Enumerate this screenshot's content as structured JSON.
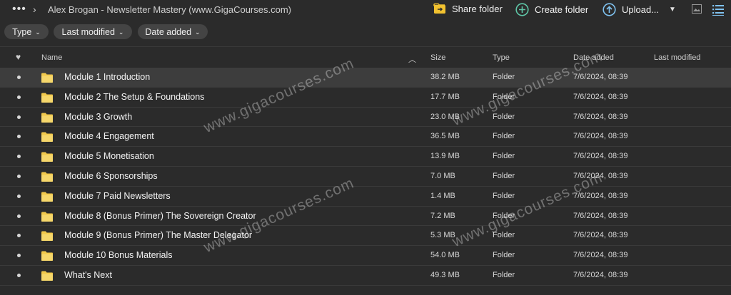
{
  "breadcrumb": {
    "path": "Alex Brogan - Newsletter Mastery (www.GigaCourses.com)"
  },
  "toolbar": {
    "share_label": "Share folder",
    "create_label": "Create folder",
    "upload_label": "Upload...",
    "colors": {
      "share_icon": "#f2c230",
      "create_icon": "#5fc7a8",
      "upload_icon": "#7fc2f0"
    }
  },
  "filters": {
    "type": "Type",
    "last_modified": "Last modified",
    "date_added": "Date added"
  },
  "table": {
    "headers": {
      "favorite": "♥",
      "name": "Name",
      "size": "Size",
      "type": "Type",
      "date_added": "Date added",
      "last_modified": "Last modified"
    },
    "rows": [
      {
        "name": "Module 1 Introduction",
        "size": "38.2 MB",
        "type": "Folder",
        "date_added": "7/6/2024, 08:39"
      },
      {
        "name": "Module 2 The Setup & Foundations",
        "size": "17.7 MB",
        "type": "Folder",
        "date_added": "7/6/2024, 08:39"
      },
      {
        "name": "Module 3 Growth",
        "size": "23.0 MB",
        "type": "Folder",
        "date_added": "7/6/2024, 08:39"
      },
      {
        "name": "Module 4 Engagement",
        "size": "36.5 MB",
        "type": "Folder",
        "date_added": "7/6/2024, 08:39"
      },
      {
        "name": "Module 5 Monetisation",
        "size": "13.9 MB",
        "type": "Folder",
        "date_added": "7/6/2024, 08:39"
      },
      {
        "name": "Module 6 Sponsorships",
        "size": "7.0 MB",
        "type": "Folder",
        "date_added": "7/6/2024, 08:39"
      },
      {
        "name": "Module 7 Paid Newsletters",
        "size": "1.4 MB",
        "type": "Folder",
        "date_added": "7/6/2024, 08:39"
      },
      {
        "name": "Module 8 (Bonus Primer) The Sovereign Creator",
        "size": "7.2 MB",
        "type": "Folder",
        "date_added": "7/6/2024, 08:39"
      },
      {
        "name": "Module 9 (Bonus Primer) The Master Delegator",
        "size": "5.3 MB",
        "type": "Folder",
        "date_added": "7/6/2024, 08:39"
      },
      {
        "name": "Module 10 Bonus Materials",
        "size": "54.0 MB",
        "type": "Folder",
        "date_added": "7/6/2024, 08:39"
      },
      {
        "name": "What's Next",
        "size": "49.3 MB",
        "type": "Folder",
        "date_added": "7/6/2024, 08:39"
      }
    ]
  },
  "watermark": "www.gigacourses.com"
}
